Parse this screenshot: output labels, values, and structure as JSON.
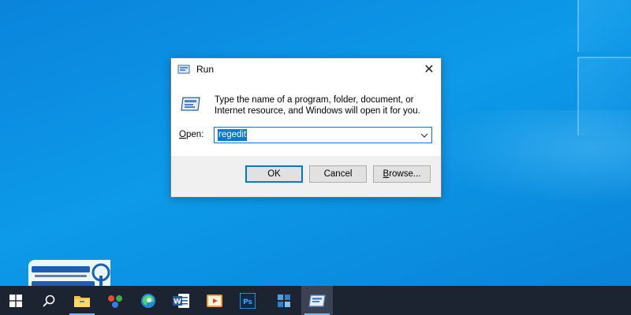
{
  "dialog": {
    "title": "Run",
    "description": "Type the name of a program, folder, document, or Internet resource, and Windows will open it for you.",
    "open_label_hotkey": "O",
    "open_label_rest": "pen:",
    "open_value": "regedit",
    "close_glyph": "✕",
    "buttons": {
      "ok": "OK",
      "cancel": "Cancel",
      "browse_hotkey": "B",
      "browse_rest": "rowse..."
    }
  },
  "taskbar": {
    "items": [
      "start",
      "search",
      "file-explorer",
      "app-dots",
      "edge",
      "word",
      "media-player",
      "photoshop",
      "app-gear",
      "run"
    ],
    "active": "run"
  },
  "colors": {
    "accent": "#0078d7",
    "taskbar": "#1c2331",
    "desktop": "#0d9ae8"
  }
}
